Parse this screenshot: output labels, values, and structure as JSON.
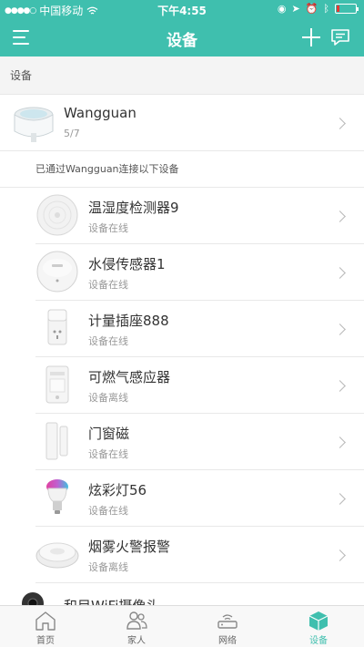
{
  "status_bar": {
    "carrier": "中国移动",
    "time": "下午4:55"
  },
  "nav": {
    "title": "设备"
  },
  "section_title": "设备",
  "gateway": {
    "name": "Wangguan",
    "count": "5/7"
  },
  "connected_hint": "已通过Wangguan连接以下设备",
  "devices": [
    {
      "name": "温湿度检测器9",
      "status": "设备在线"
    },
    {
      "name": "水侵传感器1",
      "status": "设备在线"
    },
    {
      "name": "计量插座888",
      "status": "设备在线"
    },
    {
      "name": "可燃气感应器",
      "status": "设备离线"
    },
    {
      "name": "门窗磁",
      "status": "设备在线"
    },
    {
      "name": "炫彩灯56",
      "status": "设备在线"
    },
    {
      "name": "烟雾火警报警",
      "status": "设备离线"
    }
  ],
  "camera": {
    "name": "和目WiFi摄像头"
  },
  "tabs": [
    {
      "label": "首页",
      "icon": "home-icon",
      "active": false
    },
    {
      "label": "家人",
      "icon": "family-icon",
      "active": false
    },
    {
      "label": "网络",
      "icon": "router-icon",
      "active": false
    },
    {
      "label": "设备",
      "icon": "device-cube-icon",
      "active": true
    }
  ],
  "colors": {
    "accent": "#3fbfae"
  }
}
